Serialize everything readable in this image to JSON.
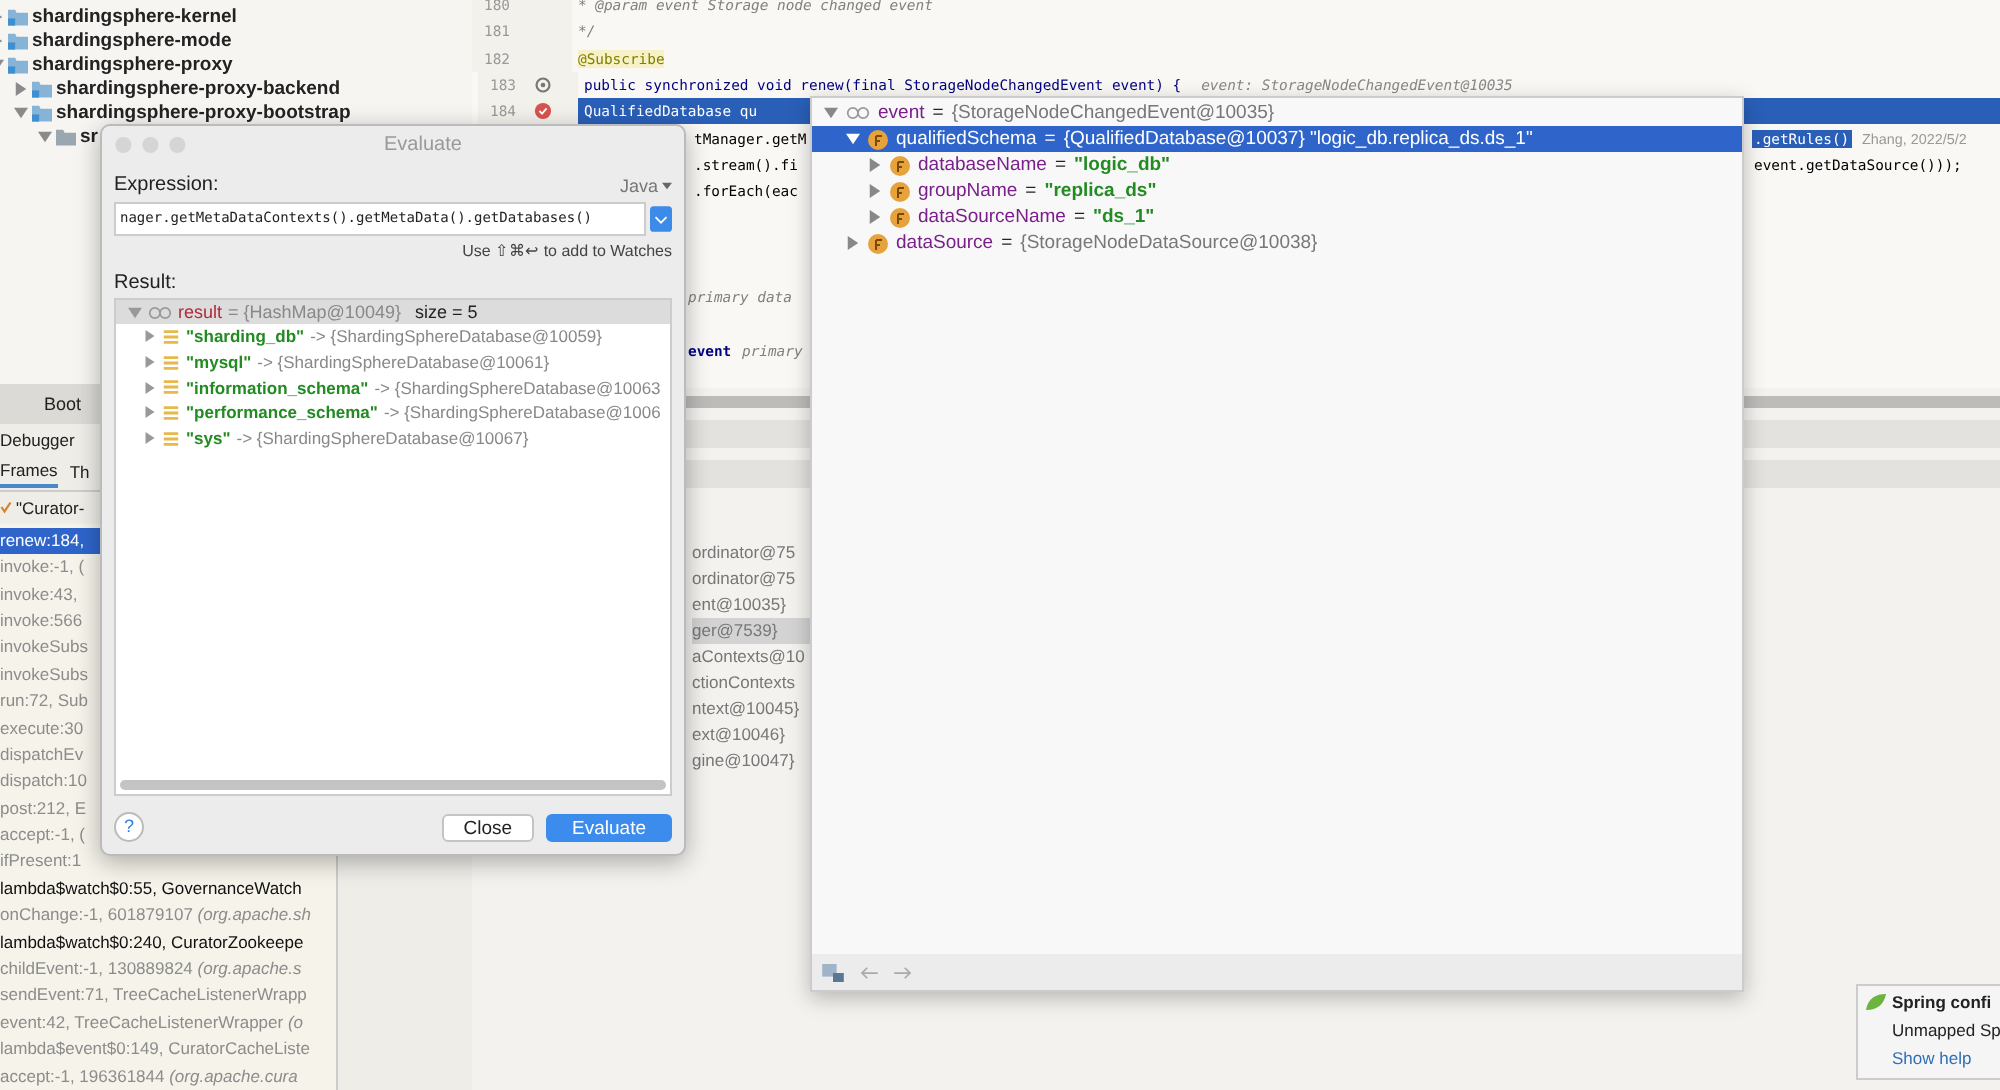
{
  "project_tree": [
    {
      "label": "shardingsphere-kernel",
      "kind": "module",
      "expanded": false
    },
    {
      "label": "shardingsphere-mode",
      "kind": "module",
      "expanded": false
    },
    {
      "label": "shardingsphere-proxy",
      "kind": "module",
      "expanded": true,
      "children": [
        {
          "label": "shardingsphere-proxy-backend",
          "kind": "module",
          "expanded": false
        },
        {
          "label": "shardingsphere-proxy-bootstrap",
          "kind": "module",
          "expanded": true,
          "children": [
            {
              "label": "sr",
              "kind": "folder",
              "expanded": true
            }
          ]
        }
      ]
    }
  ],
  "debug_panel": {
    "run_tab": "Boot",
    "tool_title": "Debugger",
    "tabs": [
      {
        "label": "Frames",
        "selected": true
      },
      {
        "label": "Th",
        "selected": false
      }
    ],
    "thread": "\"Curator-",
    "frames": [
      {
        "text": "renew:184,",
        "library": false,
        "selected": true
      },
      {
        "text": "invoke:-1, (",
        "library": true,
        "selected": false
      },
      {
        "text": "invoke:43,",
        "library": true,
        "selected": false
      },
      {
        "text": "invoke:566",
        "library": true,
        "selected": false
      },
      {
        "text": "invokeSubs",
        "library": true,
        "selected": false
      },
      {
        "text": "invokeSubs",
        "library": true,
        "selected": false
      },
      {
        "text": "run:72, Sub",
        "library": true,
        "selected": false
      },
      {
        "text": "execute:30",
        "library": true,
        "selected": false
      },
      {
        "text": "dispatchEv",
        "library": true,
        "selected": false
      },
      {
        "text": "dispatch:10",
        "library": true,
        "selected": false
      },
      {
        "text": "post:212, E",
        "library": true,
        "selected": false
      },
      {
        "text": "accept:-1, (",
        "library": true,
        "selected": false
      },
      {
        "text": "ifPresent:1",
        "library": true,
        "selected": false
      },
      {
        "text": "lambda$watch$0:55, GovernanceWatch",
        "library": false,
        "selected": false
      },
      {
        "text": "onChange:-1, 601879107 *(org.apache.sh*",
        "library": true,
        "selected": false
      },
      {
        "text": "lambda$watch$0:240, CuratorZookeepe",
        "library": false,
        "selected": false
      },
      {
        "text": "childEvent:-1, 130889824 *(org.apache.s*",
        "library": true,
        "selected": false
      },
      {
        "text": "sendEvent:71, TreeCacheListenerWrapp",
        "library": true,
        "selected": false
      },
      {
        "text": "event:42, TreeCacheListenerWrapper *(o*",
        "library": true,
        "selected": false
      },
      {
        "text": "lambda$event$0:149, CuratorCacheListe",
        "library": true,
        "selected": false
      },
      {
        "text": "accept:-1, 196361844 *(org.apache.cura*",
        "library": true,
        "selected": false
      }
    ]
  },
  "editor": {
    "lines": [
      {
        "number": "180",
        "kind": "comment",
        "code": "* @param event Storage node changed event",
        "breakpoint": false,
        "override": false,
        "execution": false
      },
      {
        "number": "181",
        "kind": "comment",
        "code": "*/",
        "breakpoint": false,
        "override": false,
        "execution": false
      },
      {
        "number": "182",
        "kind": "annotation",
        "code": "@Subscribe",
        "breakpoint": false,
        "override": false,
        "execution": false
      },
      {
        "number": "183",
        "kind": "code",
        "code": "public synchronized void renew(final StorageNodeChangedEvent event) {",
        "hint": "event: StorageNodeChangedEvent@10035",
        "breakpoint": false,
        "override": true,
        "execution": false
      },
      {
        "number": "184",
        "kind": "code",
        "code": "QualifiedDatabase qu",
        "breakpoint": true,
        "override": false,
        "execution": true
      },
      {
        "kind": "code",
        "mid": "tManager.getM",
        "right": ".getRules()",
        "blame": "Zhang, 2022/5/2"
      },
      {
        "kind": "code",
        "mid": ".stream().fi",
        "right": "event.getDataSource()));"
      },
      {
        "kind": "code",
        "mid": ".forEach(eac"
      },
      {
        "kind": "blank"
      },
      {
        "kind": "blank"
      },
      {
        "kind": "blank"
      },
      {
        "kind": "comment",
        "mid": "primary data"
      },
      {
        "kind": "blank"
      },
      {
        "kind": "comment",
        "mid": "primary",
        "mid_bold": "event"
      }
    ]
  },
  "variables": [
    {
      "text": "ordinator@75",
      "selected": false
    },
    {
      "text": "ordinator@75",
      "selected": false
    },
    {
      "text": "ent@10035}",
      "selected": false
    },
    {
      "text": "ger@7539}",
      "selected": true
    },
    {
      "text": "aContexts@10",
      "selected": false
    },
    {
      "text": "ctionContexts",
      "selected": false
    },
    {
      "text": "ntext@10045}",
      "selected": false
    },
    {
      "text": "ext@10046}",
      "selected": false
    },
    {
      "text": "gine@10047}",
      "selected": false
    }
  ],
  "evaluate_dialog": {
    "title": "Evaluate",
    "expression_label": "Expression:",
    "language": "Java",
    "expression": "nager.getMetaDataContexts().getMetaData().getDatabases()",
    "watch_hint": "Use ⇧⌘↩ to add to Watches",
    "result_label": "Result:",
    "result": {
      "name": "result",
      "value": "= {HashMap@10049}",
      "size": "size = 5",
      "expanded": true,
      "children": [
        {
          "key": "\"sharding_db\"",
          "value": "-> {ShardingSphereDatabase@10059}"
        },
        {
          "key": "\"mysql\"",
          "value": "-> {ShardingSphereDatabase@10061}"
        },
        {
          "key": "\"information_schema\"",
          "value": "-> {ShardingSphereDatabase@10063"
        },
        {
          "key": "\"performance_schema\"",
          "value": "-> {ShardingSphereDatabase@1006"
        },
        {
          "key": "\"sys\"",
          "value": "-> {ShardingSphereDatabase@10067}"
        }
      ]
    },
    "help": "?",
    "buttons": [
      {
        "label": "Close",
        "default": false
      },
      {
        "label": "Evaluate",
        "default": true
      }
    ]
  },
  "inspect_popup": {
    "tree": [
      {
        "kind": "watch",
        "name": "event",
        "sep": "=",
        "value": "{StorageNodeChangedEvent@10035}",
        "string": false,
        "expanded": true,
        "selected": false,
        "children": [
          {
            "kind": "field",
            "name": "qualifiedSchema",
            "sep": "=",
            "value": "{QualifiedDatabase@10037} \"logic_db.replica_ds.ds_1\"",
            "string": false,
            "expanded": true,
            "selected": true,
            "children": [
              {
                "kind": "field",
                "name": "databaseName",
                "sep": "=",
                "value": "\"logic_db\"",
                "string": true,
                "expanded": false,
                "selected": false
              },
              {
                "kind": "field",
                "name": "groupName",
                "sep": "=",
                "value": "\"replica_ds\"",
                "string": true,
                "expanded": false,
                "selected": false
              },
              {
                "kind": "field",
                "name": "dataSourceName",
                "sep": "=",
                "value": "\"ds_1\"",
                "string": true,
                "expanded": false,
                "selected": false
              }
            ]
          },
          {
            "kind": "field",
            "name": "dataSource",
            "sep": "=",
            "value": "{StorageNodeDataSource@10038}",
            "string": false,
            "expanded": false,
            "selected": false
          }
        ]
      }
    ]
  },
  "notification": {
    "title": "Spring confi",
    "body": "Unmapped Sp",
    "link": "Show help"
  }
}
